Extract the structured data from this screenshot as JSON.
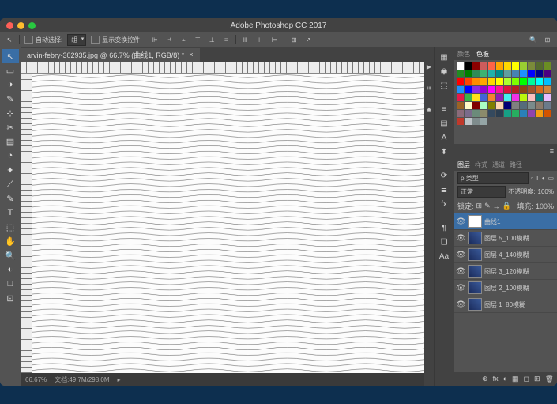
{
  "app_title": "Adobe Photoshop CC 2017",
  "traffic": [
    "#ff5f57",
    "#febc2e",
    "#28c840"
  ],
  "options_bar": {
    "auto_select_label": "自动选择:",
    "auto_select_value": "组",
    "show_transform": "显示变换控件"
  },
  "document": {
    "tab_label": "arvin-febry-302935.jpg @ 66.7% (曲线1, RGB/8) *",
    "zoom": "66.67%",
    "doc_size": "文档:49.7M/298.0M"
  },
  "tools": [
    "↖",
    "▭",
    "◑",
    "✎",
    "⊹",
    "✂",
    "▤",
    "◔",
    "✦",
    "⟋",
    "✎",
    "T",
    "⬚",
    "✋",
    "🔍",
    "◐",
    "□",
    "⊡"
  ],
  "collapsed_icons": [
    "▦",
    "◉",
    "⬚",
    "≡",
    "▤",
    "A",
    "⬍",
    "⟳",
    "≣",
    "fx",
    "¶",
    "❏",
    "Aa"
  ],
  "vtabs": [
    "▶",
    "≡",
    "◉"
  ],
  "swatch_panel": {
    "tabs": [
      "颜色",
      "色板"
    ],
    "active": 1,
    "colors": [
      "#fff",
      "#000",
      "#8b0000",
      "#cd5c5c",
      "#ff6347",
      "#ffa500",
      "#ffd700",
      "#ffff00",
      "#9acd32",
      "#7b8b3a",
      "#556b2f",
      "#6b8e23",
      "#228b22",
      "#008000",
      "#2e8b57",
      "#3cb371",
      "#20b2aa",
      "#008b8b",
      "#5f9ea0",
      "#4682b4",
      "#1e90ff",
      "#0000ff",
      "#00008b",
      "#4b0082",
      "#ff0000",
      "#ff4500",
      "#ff8c00",
      "#ffa500",
      "#ffd700",
      "#ffff00",
      "#adff2f",
      "#7fff00",
      "#00ff00",
      "#00fa9a",
      "#00ffff",
      "#00bfff",
      "#1e90ff",
      "#0000ff",
      "#8a2be2",
      "#9400d3",
      "#ff00ff",
      "#ff1493",
      "#dc143c",
      "#b22222",
      "#8b4513",
      "#a0522d",
      "#d2691e",
      "#cd853f",
      "#e6194b",
      "#3cb44b",
      "#ffe119",
      "#4363d8",
      "#f58231",
      "#911eb4",
      "#46f0f0",
      "#f032e6",
      "#bcf60c",
      "#fabebe",
      "#008080",
      "#e6beff",
      "#9a6324",
      "#fffac8",
      "#800000",
      "#aaffc3",
      "#808000",
      "#ffd8b1",
      "#000075",
      "#808080",
      "#556b7a",
      "#7a8b8b",
      "#8b7a6b",
      "#6b7a8b",
      "#8b6b7a",
      "#7a6b8b",
      "#6b8b7a",
      "#8b8b6b",
      "#34495e",
      "#2c3e50",
      "#16a085",
      "#27ae60",
      "#2980b9",
      "#8e44ad",
      "#f39c12",
      "#d35400",
      "#c0392b",
      "#bdc3c7",
      "#7f8c8d",
      "#95a5a6"
    ]
  },
  "layer_panel": {
    "tabs": [
      "图层",
      "样式",
      "通道",
      "路径"
    ],
    "active": 0,
    "kind_label": "ρ 类型",
    "blend_mode": "正常",
    "opacity_label": "不透明度:",
    "opacity": "100%",
    "lock_label": "锁定:",
    "fill_label": "填充:",
    "fill": "100%",
    "layers": [
      {
        "name": "曲线1",
        "visible": true,
        "blank": true,
        "selected": true
      },
      {
        "name": "图层 5_100模糊",
        "visible": true
      },
      {
        "name": "图层 4_140模糊",
        "visible": true
      },
      {
        "name": "图层 3_120模糊",
        "visible": true
      },
      {
        "name": "图层 2_100模糊",
        "visible": true
      },
      {
        "name": "图层 1_80模糊",
        "visible": true
      }
    ],
    "footer_icons": [
      "⊕",
      "fx",
      "◐",
      "▦",
      "◻",
      "⊞",
      "🗑"
    ]
  }
}
